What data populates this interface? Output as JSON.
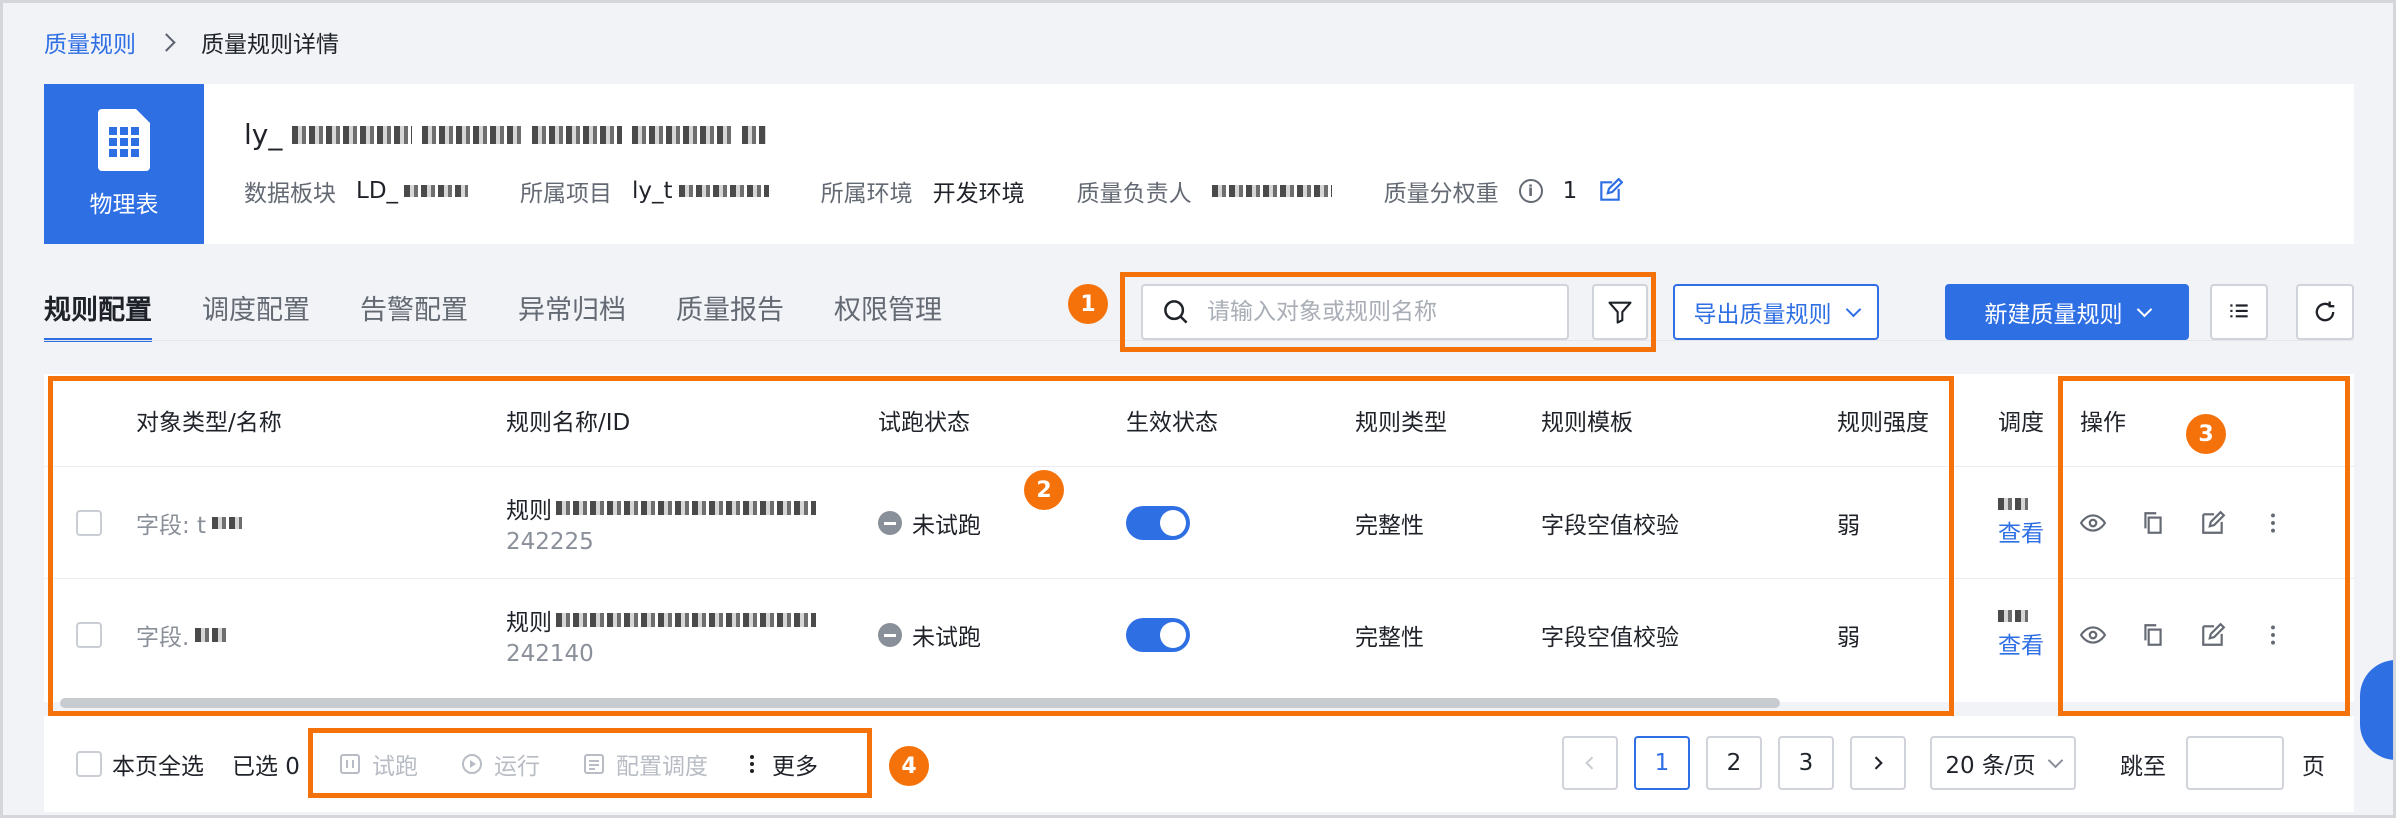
{
  "breadcrumb": {
    "parent": "质量规则",
    "current": "质量规则详情"
  },
  "header": {
    "tile_label": "物理表",
    "title_prefix": "ly_",
    "meta": [
      {
        "key": "数据板块",
        "value": "LD_"
      },
      {
        "key": "所属项目",
        "value": "ly_t"
      },
      {
        "key": "所属环境",
        "value": "开发环境"
      },
      {
        "key": "质量负责人",
        "value": ""
      }
    ],
    "weight_label": "质量分权重",
    "weight_value": "1"
  },
  "tabs": [
    "规则配置",
    "调度配置",
    "告警配置",
    "异常归档",
    "质量报告",
    "权限管理"
  ],
  "toolbar": {
    "search_placeholder": "请输入对象或规则名称",
    "export_label": "导出质量规则",
    "new_label": "新建质量规则"
  },
  "table": {
    "columns": [
      "对象类型/名称",
      "规则名称/ID",
      "试跑状态",
      "生效状态",
      "规则类型",
      "规则模板",
      "规则强度",
      "调度",
      "操作"
    ],
    "rows": [
      {
        "object": "字段: t",
        "rule_name": "规则",
        "rule_id": "242225",
        "trial": "未试跑",
        "rule_type": "完整性",
        "template": "字段空值校验",
        "strength": "弱",
        "schedule_link": "查看"
      },
      {
        "object": "字段.",
        "rule_name": "规则",
        "rule_id": "242140",
        "trial": "未试跑",
        "rule_type": "完整性",
        "template": "字段空值校验",
        "strength": "弱",
        "schedule_link": "查看"
      }
    ]
  },
  "footer": {
    "select_all": "本页全选",
    "selected": "已选 0",
    "actions": [
      "试跑",
      "运行",
      "配置调度",
      "更多"
    ],
    "pages": [
      "1",
      "2",
      "3"
    ],
    "page_size": "20 条/页",
    "jump_label": "跳至",
    "page_unit": "页"
  },
  "badges": [
    "1",
    "2",
    "3",
    "4"
  ],
  "colors": {
    "accent": "#2f6fe4",
    "highlight": "#f5710a"
  }
}
